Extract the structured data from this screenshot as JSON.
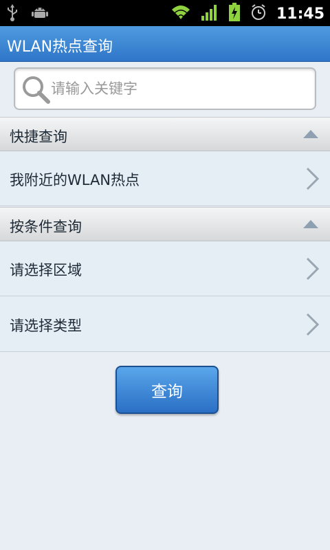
{
  "status_bar": {
    "time": "11:45",
    "icons": [
      "usb-icon",
      "android-debug-icon",
      "wifi-icon",
      "signal-icon",
      "battery-charging-icon",
      "alarm-icon"
    ]
  },
  "title_bar": {
    "title": "WLAN热点查询"
  },
  "search": {
    "placeholder": "请输入关键字",
    "value": ""
  },
  "sections": [
    {
      "header": "快捷查询",
      "rows": [
        {
          "label": "我附近的WLAN热点"
        }
      ]
    },
    {
      "header": "按条件查询",
      "rows": [
        {
          "label": "请选择区域"
        },
        {
          "label": "请选择类型"
        }
      ]
    }
  ],
  "query_button": {
    "label": "查询"
  },
  "colors": {
    "title_bar": "#2f76c8",
    "background": "#e8eef4",
    "button": "#2a6fc5"
  }
}
